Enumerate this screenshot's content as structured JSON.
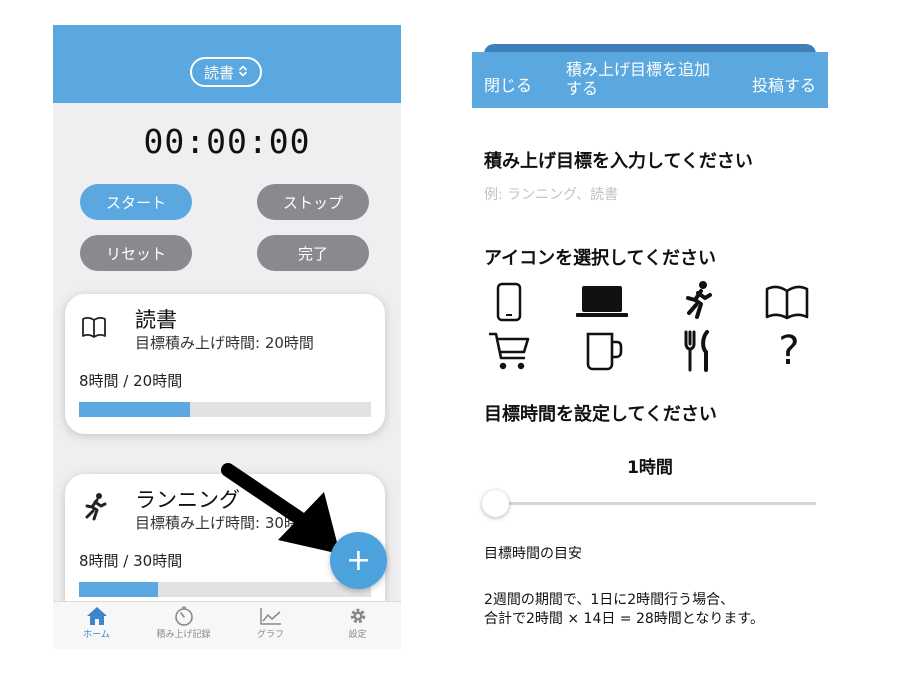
{
  "left": {
    "picker_label": "読書",
    "timer": "00:00:00",
    "buttons": {
      "start": "スタート",
      "stop": "ストップ",
      "reset": "リセット",
      "done": "完了"
    },
    "cards": [
      {
        "icon": "book-icon",
        "title": "読書",
        "target": "目標積み上げ時間: 20時間",
        "progress_text": "8時間 / 20時間",
        "progress": 0.38
      },
      {
        "icon": "running-icon",
        "title": "ランニング",
        "target": "目標積み上げ時間: 30時間",
        "progress_text": "8時間 / 30時間",
        "progress": 0.27
      }
    ],
    "fab_label": "+",
    "tabs": [
      {
        "icon": "home-icon",
        "label": "ホーム",
        "active": true
      },
      {
        "icon": "timer-icon",
        "label": "積み上げ記録",
        "active": false
      },
      {
        "icon": "graph-icon",
        "label": "グラフ",
        "active": false
      },
      {
        "icon": "gear-icon",
        "label": "設定",
        "active": false
      }
    ],
    "accent_color": "#5aa8df"
  },
  "right": {
    "nav": {
      "close": "閉じる",
      "title": "積み上げ目標を追加する",
      "post": "投稿する"
    },
    "goal_heading": "積み上げ目標を入力してください",
    "goal_placeholder": "例: ランニング、読書",
    "icon_heading": "アイコンを選択してください",
    "icons": [
      "smartphone-icon",
      "laptop-icon",
      "running-icon",
      "book-icon",
      "cart-icon",
      "mug-icon",
      "cutlery-icon",
      "question-icon"
    ],
    "time_heading": "目標時間を設定してください",
    "hours_value": "1時間",
    "slider_value": 0.0,
    "guide_title": "目標時間の目安",
    "guide_line1": "2週間の期間で、1日に2時間行う場合、",
    "guide_line2": "合計で2時間 × 14日 = 28時間となります。"
  }
}
